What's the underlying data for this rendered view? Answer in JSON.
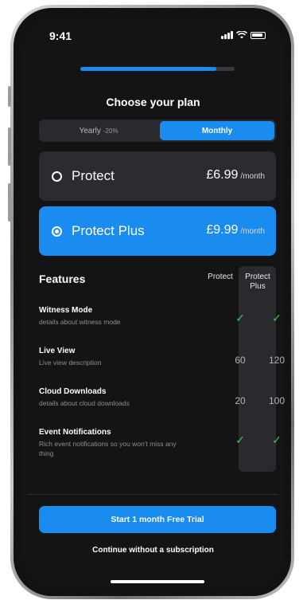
{
  "status_bar": {
    "time": "9:41"
  },
  "progress": {
    "value": 0.88
  },
  "title": "Choose your plan",
  "billing_toggle": {
    "yearly_label": "Yearly",
    "yearly_discount": "-20%",
    "monthly_label": "Monthly",
    "selected": "Monthly"
  },
  "plans": [
    {
      "name": "Protect",
      "price": "£6.99",
      "period": "/month",
      "selected": false
    },
    {
      "name": "Protect Plus",
      "price": "£9.99",
      "period": "/month",
      "selected": true
    }
  ],
  "features": {
    "title": "Features",
    "columns": [
      "Protect",
      "Protect Plus"
    ],
    "rows": [
      {
        "name": "Witness Mode",
        "description": "details about witness mode",
        "protect": "✓",
        "plus": "✓"
      },
      {
        "name": "Live View",
        "description": "Live view description",
        "protect": "60",
        "plus": "120"
      },
      {
        "name": "Cloud Downloads",
        "description": "details about cloud downloads",
        "protect": "20",
        "plus": "100"
      },
      {
        "name": "Event Notifications",
        "description": "Rich event notifications so you won't miss any thing",
        "protect": "✓",
        "plus": "✓"
      }
    ]
  },
  "cta": {
    "label": "Start 1 month Free Trial"
  },
  "skip": {
    "label": "Continue without a subscription"
  },
  "colors": {
    "accent": "#1a8cf0",
    "background": "#141416",
    "card": "#2c2c30",
    "check": "#34c759"
  }
}
